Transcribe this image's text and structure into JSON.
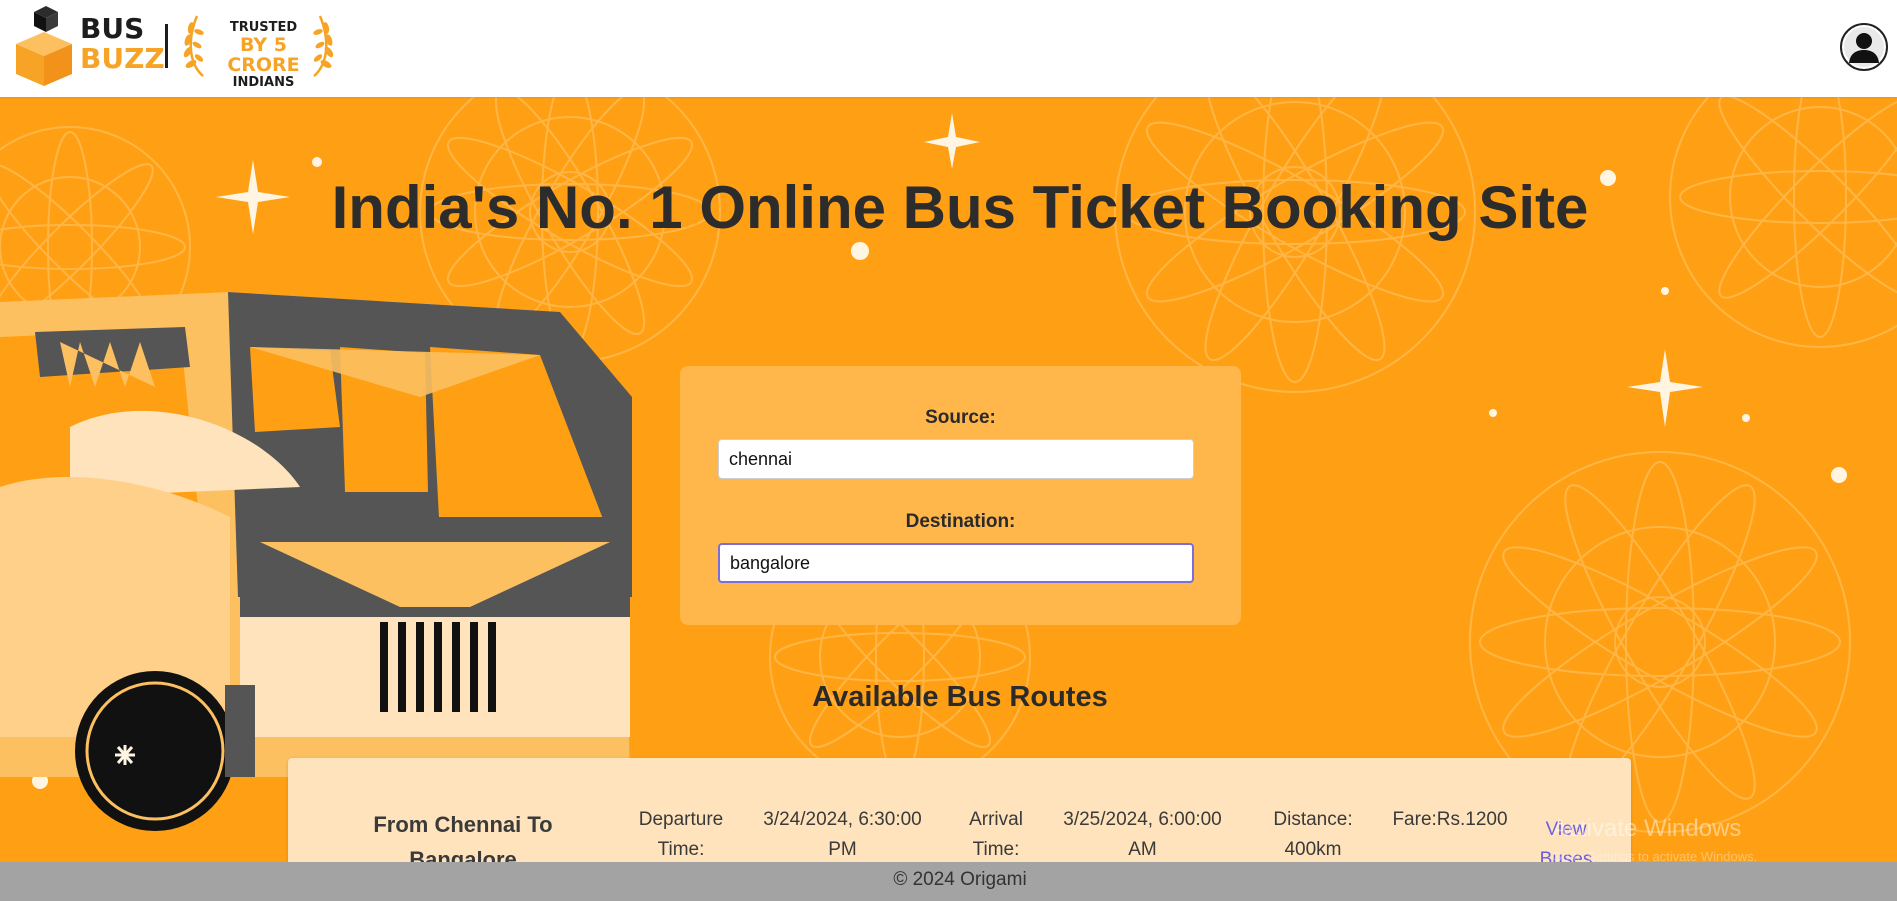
{
  "brand": {
    "logo_line1": "BUS",
    "logo_line2": "BUZZ",
    "trusted_line1": "TRUSTED",
    "trusted_line2": "BY 5 CRORE",
    "trusted_line3": "INDIANS",
    "accent_color": "#f7a426"
  },
  "hero": {
    "title": "India's No. 1 Online Bus Ticket Booking Site",
    "background_color": "#ffa014"
  },
  "search": {
    "source_label": "Source:",
    "source_value": "chennai",
    "destination_label": "Destination:",
    "destination_value": "bangalore"
  },
  "routes": {
    "heading": "Available Bus Routes",
    "items": [
      {
        "title": "From Chennai To Bangalore",
        "departure_label": "Departure Time:",
        "departure_value": "3/24/2024, 6:30:00 PM",
        "arrival_label": "Arrival Time:",
        "arrival_value": "3/25/2024, 6:00:00 AM",
        "distance": "Distance: 400km",
        "fare": "Fare:Rs.1200",
        "link_label": "View Buses"
      }
    ]
  },
  "watermark": {
    "title": "Activate Windows",
    "subtitle": "Go to Settings to activate Windows."
  },
  "footer": {
    "text": "© 2024 Origami"
  }
}
